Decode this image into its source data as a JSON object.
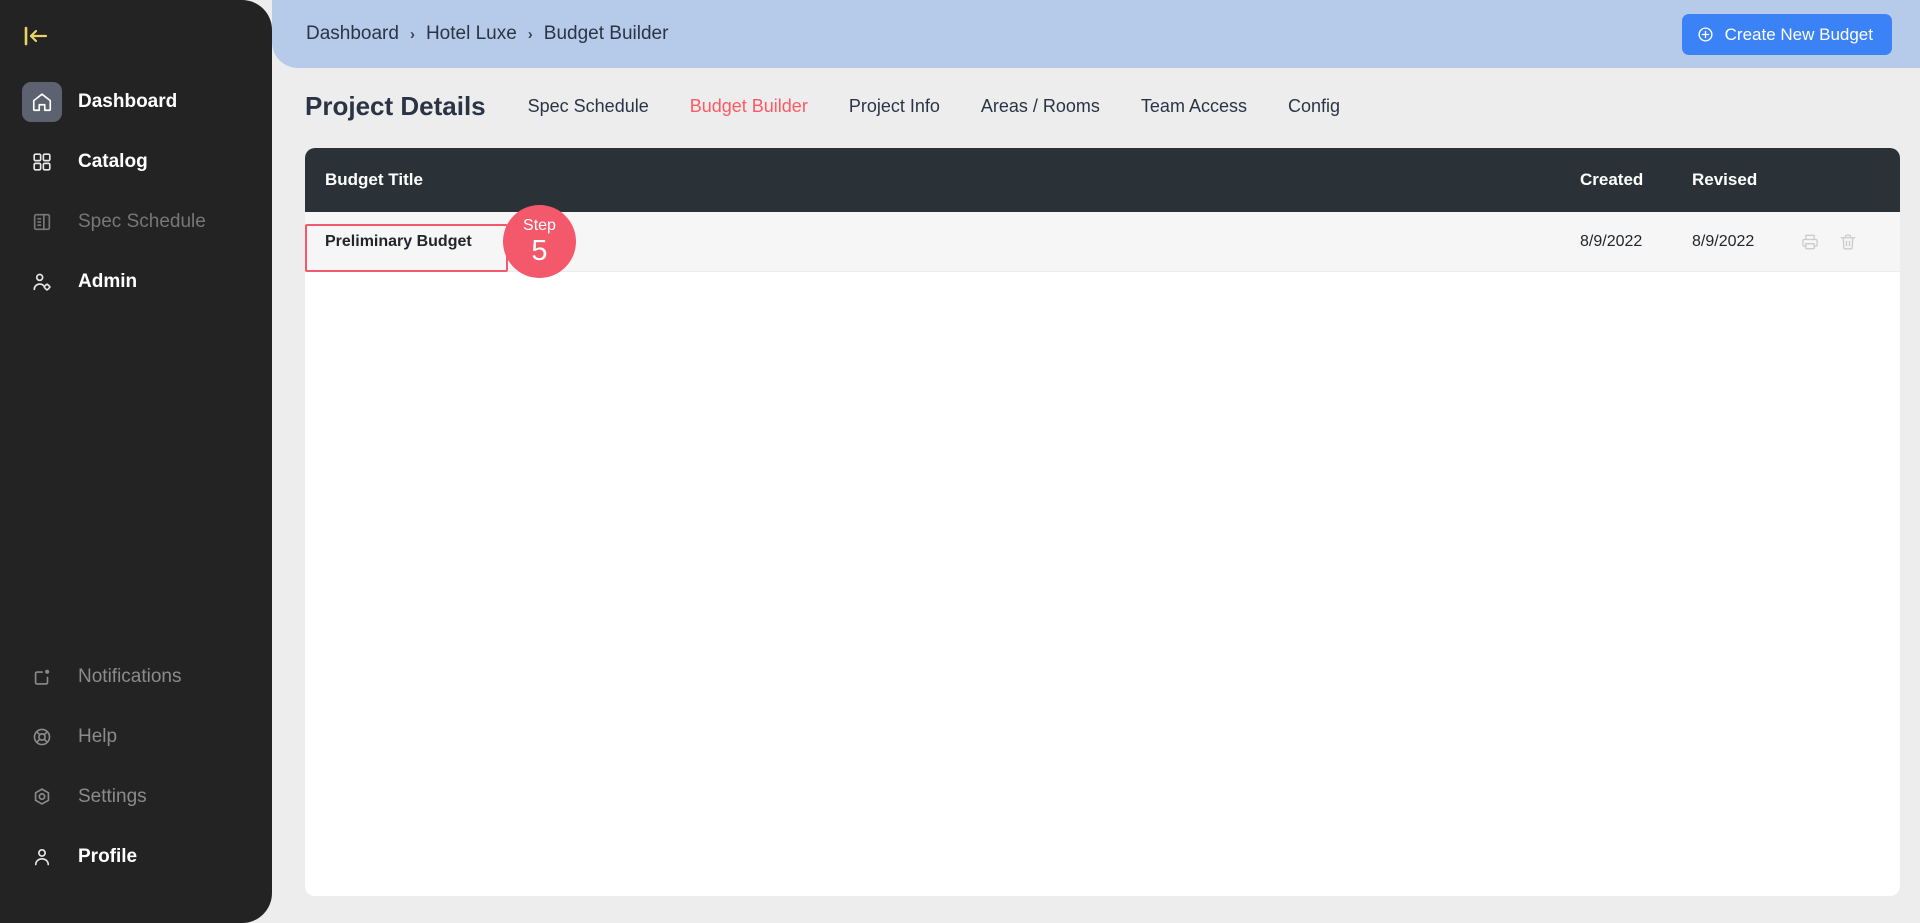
{
  "sidebar": {
    "collapse_icon": "collapse-sidebar-icon",
    "top_items": [
      {
        "label": "Dashboard",
        "icon": "home-icon",
        "state": "active"
      },
      {
        "label": "Catalog",
        "icon": "grid-icon",
        "state": "strong"
      },
      {
        "label": "Spec Schedule",
        "icon": "document-list-icon",
        "state": "dim"
      },
      {
        "label": "Admin",
        "icon": "user-cog-icon",
        "state": "strong"
      }
    ],
    "bottom_items": [
      {
        "label": "Notifications",
        "icon": "bell-square-icon",
        "state": "mid"
      },
      {
        "label": "Help",
        "icon": "lifebuoy-icon",
        "state": "mid"
      },
      {
        "label": "Settings",
        "icon": "gear-hex-icon",
        "state": "mid"
      },
      {
        "label": "Profile",
        "icon": "user-icon",
        "state": "strong"
      }
    ]
  },
  "header": {
    "breadcrumb": [
      "Dashboard",
      "Hotel Luxe",
      "Budget Builder"
    ],
    "separator": "›",
    "create_button": {
      "label": "Create New Budget",
      "icon": "plus-circle-icon"
    },
    "background_color": "#b6cbe9",
    "button_color": "#3b82f6"
  },
  "page": {
    "title": "Project Details",
    "tabs": [
      {
        "label": "Spec Schedule",
        "active": false
      },
      {
        "label": "Budget Builder",
        "active": true
      },
      {
        "label": "Project Info",
        "active": false
      },
      {
        "label": "Areas / Rooms",
        "active": false
      },
      {
        "label": "Team Access",
        "active": false
      },
      {
        "label": "Config",
        "active": false
      }
    ],
    "active_tab_color": "#fc5a65"
  },
  "table": {
    "columns": [
      "Budget Title",
      "Created",
      "Revised"
    ],
    "rows": [
      {
        "title": "Preliminary Budget",
        "created": "8/9/2022",
        "revised": "8/9/2022",
        "actions": [
          "print-icon",
          "trash-icon"
        ]
      }
    ]
  },
  "overlay": {
    "step_word": "Step",
    "step_number": "5",
    "accent_color": "#f4596b"
  }
}
